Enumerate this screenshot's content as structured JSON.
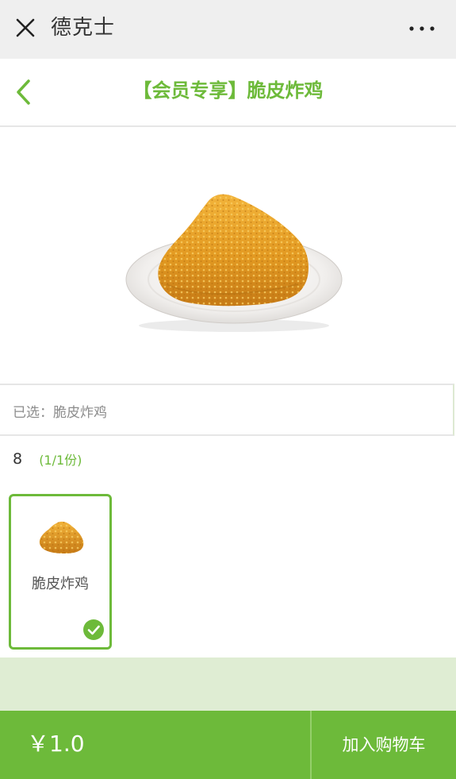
{
  "topbar": {
    "title": "德克士",
    "close_icon": "close-icon",
    "more_icon": "more-icon"
  },
  "header": {
    "title": "【会员专享】脆皮炸鸡",
    "back_icon": "chevron-left-icon"
  },
  "selected": {
    "text": "已选：脆皮炸鸡"
  },
  "group": {
    "number": "8",
    "count": "(1/1份)"
  },
  "options": [
    {
      "label": "脆皮炸鸡",
      "selected": true
    }
  ],
  "bottom_bar": {
    "price": "￥1.0",
    "add_to_cart": "加入购物车"
  },
  "colors": {
    "accent": "#6dba3a",
    "band": "#dfedd3",
    "topbar": "#efefef"
  }
}
